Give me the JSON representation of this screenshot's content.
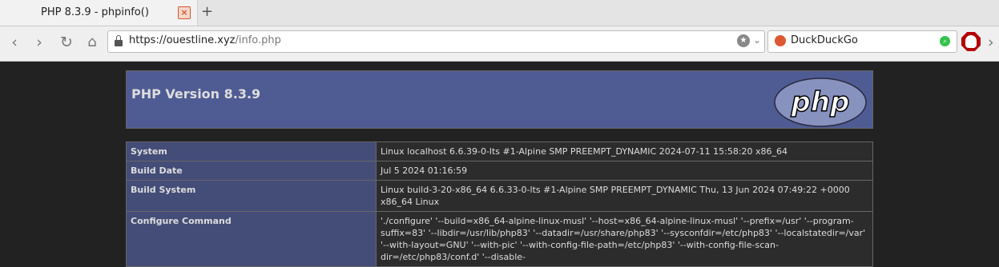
{
  "browser": {
    "tab_title": "PHP 8.3.9 - phpinfo()",
    "close_tab": "×",
    "new_tab": "+",
    "url_host": "https://ouestline.xyz",
    "url_path": "/info.php",
    "search_engine": "DuckDuckGo"
  },
  "php": {
    "version": "PHP Version 8.3.9",
    "logo_text": "php",
    "rows": [
      {
        "key": "System",
        "value": "Linux localhost 6.6.39-0-lts #1-Alpine SMP PREEMPT_DYNAMIC 2024-07-11 15:58:20 x86_64"
      },
      {
        "key": "Build Date",
        "value": "Jul 5 2024 01:16:59"
      },
      {
        "key": "Build System",
        "value": "Linux build-3-20-x86_64 6.6.33-0-lts #1-Alpine SMP PREEMPT_DYNAMIC Thu, 13 Jun 2024 07:49:22 +0000 x86_64 Linux"
      },
      {
        "key": "Configure Command",
        "value": "'./configure' '--build=x86_64-alpine-linux-musl' '--host=x86_64-alpine-linux-musl' '--prefix=/usr' '--program-suffix=83' '--libdir=/usr/lib/php83' '--datadir=/usr/share/php83' '--sysconfdir=/etc/php83' '--localstatedir=/var' '--with-layout=GNU' '--with-pic' '--with-config-file-path=/etc/php83' '--with-config-file-scan-dir=/etc/php83/conf.d' '--disable-"
      }
    ]
  },
  "colors": {
    "header_bg": "#4f5b93",
    "key_bg": "#444d78",
    "value_bg": "#2c2c2c",
    "page_bg": "#222222"
  }
}
